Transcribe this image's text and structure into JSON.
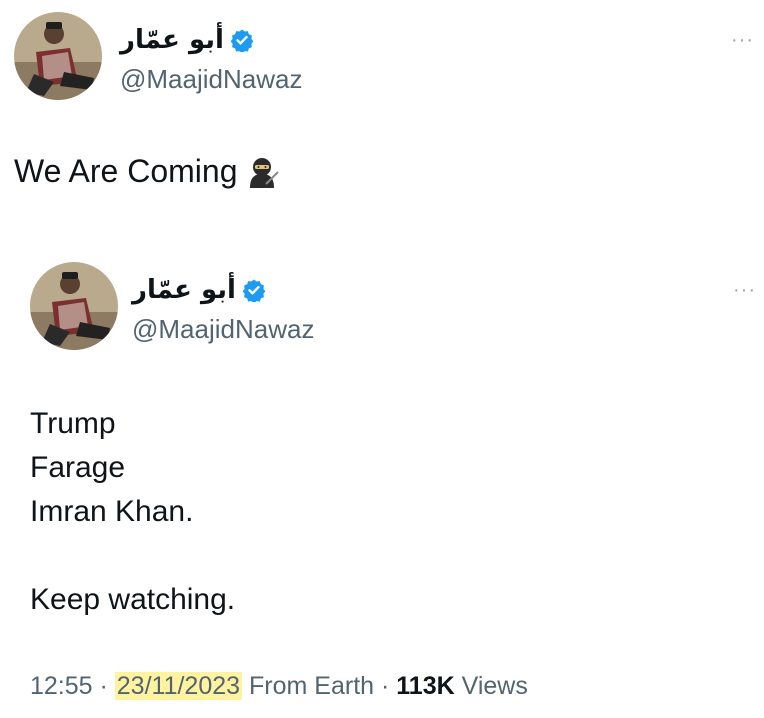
{
  "outer_tweet": {
    "author": {
      "display_name": "أبو عمّار",
      "handle": "@MaajidNawaz",
      "verified": true,
      "avatar_icon": "profile-photo"
    },
    "more_label": "···",
    "text": "We Are Coming",
    "emoji": "ninja-emoji"
  },
  "quoted_tweet": {
    "author": {
      "display_name": "أبو عمّار",
      "handle": "@MaajidNawaz",
      "verified": true,
      "avatar_icon": "profile-photo"
    },
    "more_label": "···",
    "lines": [
      "Trump",
      "Farage",
      "Imran Khan.",
      "",
      "Keep watching."
    ],
    "meta": {
      "time": "12:55",
      "separator": " · ",
      "date": "23/11/2023",
      "source": "From Earth",
      "separator2": " · ",
      "views_count": "113K",
      "views_label": "Views"
    }
  },
  "colors": {
    "text": "#0f1419",
    "secondary": "#536471",
    "verified": "#1d9bf0",
    "highlight": "#fff3a0"
  }
}
